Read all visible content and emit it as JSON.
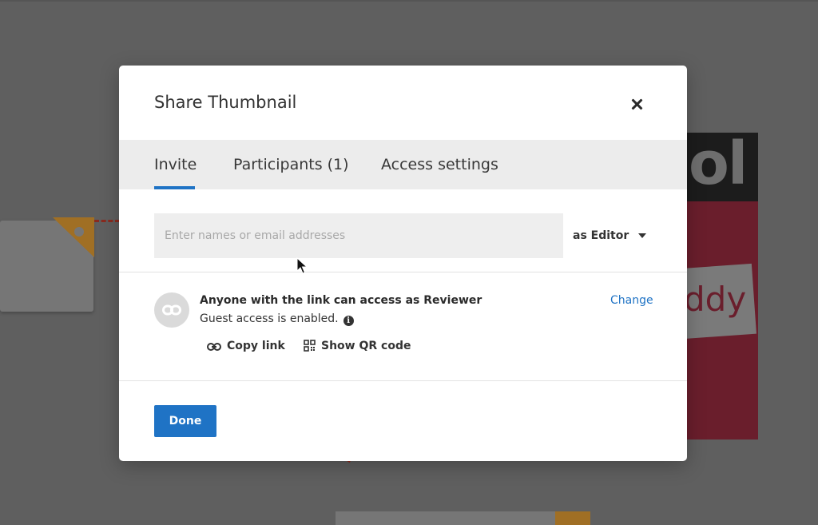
{
  "background": {
    "poster_heading": "ol",
    "poster_label": "ddy"
  },
  "dialog": {
    "title": "Share Thumbnail",
    "close_icon": "close-icon",
    "tabs": [
      {
        "label": "Invite",
        "active": true
      },
      {
        "label": "Participants (1)",
        "active": false
      },
      {
        "label": "Access settings",
        "active": false
      }
    ],
    "invite": {
      "input_value": "",
      "input_placeholder": "Enter names or email addresses",
      "role_label": "as Editor"
    },
    "link_access": {
      "icon": "link-icon",
      "title": "Anyone with the link can access as Reviewer",
      "subtitle": "Guest access is enabled.",
      "info_icon": "info-icon",
      "change_label": "Change",
      "copy_link_label": "Copy link",
      "qr_code_label": "Show QR code"
    },
    "done_label": "Done"
  },
  "colors": {
    "accent": "#1f73c5",
    "overlay": "#5f5f5f",
    "tab_bar": "#ececec",
    "input_bg": "#eeeeee"
  }
}
